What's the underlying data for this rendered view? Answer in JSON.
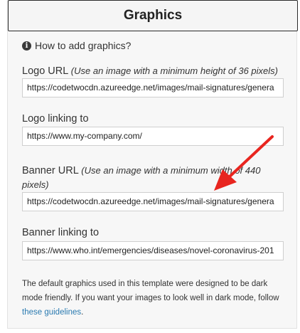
{
  "panel": {
    "title": "Graphics",
    "help_link": "How to add graphics?"
  },
  "fields": {
    "logo_url": {
      "label": "Logo URL",
      "hint": "(Use an image with a minimum height of 36 pixels)",
      "value": "https://codetwocdn.azureedge.net/images/mail-signatures/genera"
    },
    "logo_link": {
      "label": "Logo linking to",
      "value": "https://www.my-company.com/"
    },
    "banner_url": {
      "label": "Banner URL",
      "hint": "(Use an image with a minimum width of 440 pixels)",
      "value": "https://codetwocdn.azureedge.net/images/mail-signatures/genera"
    },
    "banner_link": {
      "label": "Banner linking to",
      "value": "https://www.who.int/emergencies/diseases/novel-coronavirus-201"
    }
  },
  "footer": {
    "text_before_link": "The default graphics used in this template were designed to be dark mode friendly. If you want your images to look well in dark mode, follow ",
    "link_text": "these guidelines",
    "text_after_link": "."
  },
  "annotation": {
    "arrow_color": "#e8251f"
  },
  "colors": {
    "link": "#2a7ab0",
    "panel_bg": "#f7f7f7",
    "header_border": "#2b2b2b"
  }
}
